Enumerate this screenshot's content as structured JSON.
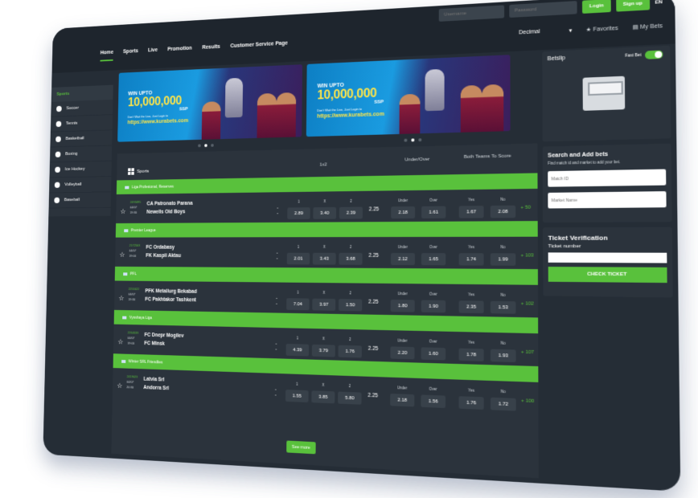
{
  "nav": [
    "Home",
    "Sports",
    "Live",
    "Promotion",
    "Results",
    "Customer Service Page"
  ],
  "auth": {
    "username_placeholder": "Username",
    "password_placeholder": "Password",
    "login": "Login",
    "signup": "Sign up",
    "lang": "EN"
  },
  "toolbar": {
    "odds_format": "Decimal",
    "favorites": "Favorites",
    "my_bets": "My Bets"
  },
  "sidebar": {
    "title": "Sports",
    "items": [
      "Soccer",
      "Tennis",
      "Basketball",
      "Boxing",
      "Ice Hockey",
      "Volleyball",
      "Baseball"
    ]
  },
  "banner": {
    "win": "WIN UPTO",
    "amount": "10,000,000",
    "currency": "SSP",
    "small": "Don't Wait the Live, Just Login to",
    "url": "https://www.kurabets.com"
  },
  "events_header": {
    "sports": "Sports",
    "col1": "1x2",
    "col2": "Under/Over",
    "col3": "Both Teams To Score"
  },
  "odds_labels": {
    "one": "1",
    "x": "X",
    "two": "2",
    "under": "Under",
    "over": "Over",
    "yes": "Yes",
    "no": "No"
  },
  "matches": [
    {
      "league": "Liga Profesional, Reserves",
      "id": "2493495",
      "date": "04/07",
      "time": "19:30",
      "home": "CA Patronato Parana",
      "away": "Newells Old Boys",
      "o1": "2.89",
      "ox": "3.40",
      "o2": "2.39",
      "hcp": "2.25",
      "under": "2.18",
      "over": "1.61",
      "yes": "1.67",
      "no": "2.08",
      "more": "+ 50"
    },
    {
      "league": "Premier League",
      "id": "2172503",
      "date": "04/07",
      "time": "19:00",
      "home": "FC Ordabasy",
      "away": "FK Kaspii Aktau",
      "o1": "2.01",
      "ox": "3.43",
      "o2": "3.68",
      "hcp": "2.25",
      "under": "2.12",
      "over": "1.65",
      "yes": "1.74",
      "no": "1.99",
      "more": "+ 103"
    },
    {
      "league": "PFL",
      "id": "2251622",
      "date": "04/07",
      "time": "19:30",
      "home": "PFK Metallurg Bekabad",
      "away": "FC Pakhtakor Tashkent",
      "o1": "7.04",
      "ox": "3.97",
      "o2": "1.50",
      "hcp": "2.25",
      "under": "1.80",
      "over": "1.90",
      "yes": "2.35",
      "no": "1.53",
      "more": "+ 102"
    },
    {
      "league": "Vysshaya Liga",
      "id": "2264533",
      "date": "04/07",
      "time": "19:00",
      "home": "FC Dnepr Mogilev",
      "away": "FC Minsk",
      "o1": "4.39",
      "ox": "3.79",
      "o2": "1.76",
      "hcp": "2.25",
      "under": "2.20",
      "over": "1.60",
      "yes": "1.78",
      "no": "1.93",
      "more": "+ 107"
    },
    {
      "league": "Winter SRL Friendlies",
      "id": "2419023",
      "date": "04/07",
      "time": "20:30",
      "home": "Latvia Srl",
      "away": "Andorra Srl",
      "o1": "1.55",
      "ox": "3.85",
      "o2": "5.80",
      "hcp": "2.25",
      "under": "2.18",
      "over": "1.56",
      "yes": "1.76",
      "no": "1.72",
      "more": "+ 100"
    }
  ],
  "see_more": "See more",
  "betslip": {
    "title": "Betslip",
    "fast_bet": "Fast Bet"
  },
  "search_bets": {
    "title": "Search and Add bets",
    "subtitle": "Find match id and market to add your bet.",
    "match_placeholder": "Match ID",
    "market_placeholder": "Market Name"
  },
  "ticket": {
    "title": "Ticket Verification",
    "subtitle": "Ticket number",
    "button": "CHECK TICKET"
  },
  "colors": {
    "accent": "#59c13c",
    "background": "#252d36",
    "panel": "#2b333c"
  }
}
